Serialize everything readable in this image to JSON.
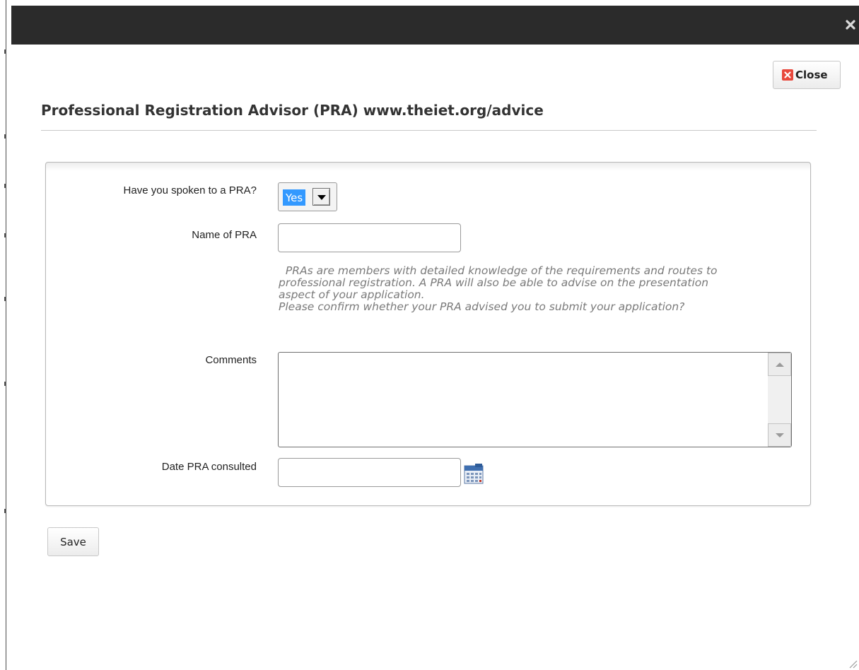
{
  "dialog": {
    "close_label": "Close",
    "title": "Professional Registration Advisor (PRA) www.theiet.org/advice"
  },
  "form": {
    "spoken_label": "Have you spoken to a PRA?",
    "spoken_value": "Yes",
    "name_label": "Name of PRA",
    "name_value": "",
    "help_lines": [
      "  PRAs are members with detailed knowledge of the requirements and routes to",
      "professional registration. A PRA will also be able to advise on the presentation",
      "aspect of your application.",
      "Please confirm whether your PRA advised you to submit your application?"
    ],
    "comments_label": "Comments",
    "comments_value": "",
    "date_label": "Date PRA consulted",
    "date_value": "",
    "save_label": "Save"
  },
  "icons": {
    "titlebar_close": "close-icon",
    "close_button": "close-x-icon",
    "calendar": "calendar-icon",
    "resize": "resize-grip-icon"
  },
  "colors": {
    "titlebar": "#2b2b2b",
    "close_icon_red": "#e8483c",
    "select_highlight": "#3399ff",
    "help_text": "#7a7a7a"
  }
}
